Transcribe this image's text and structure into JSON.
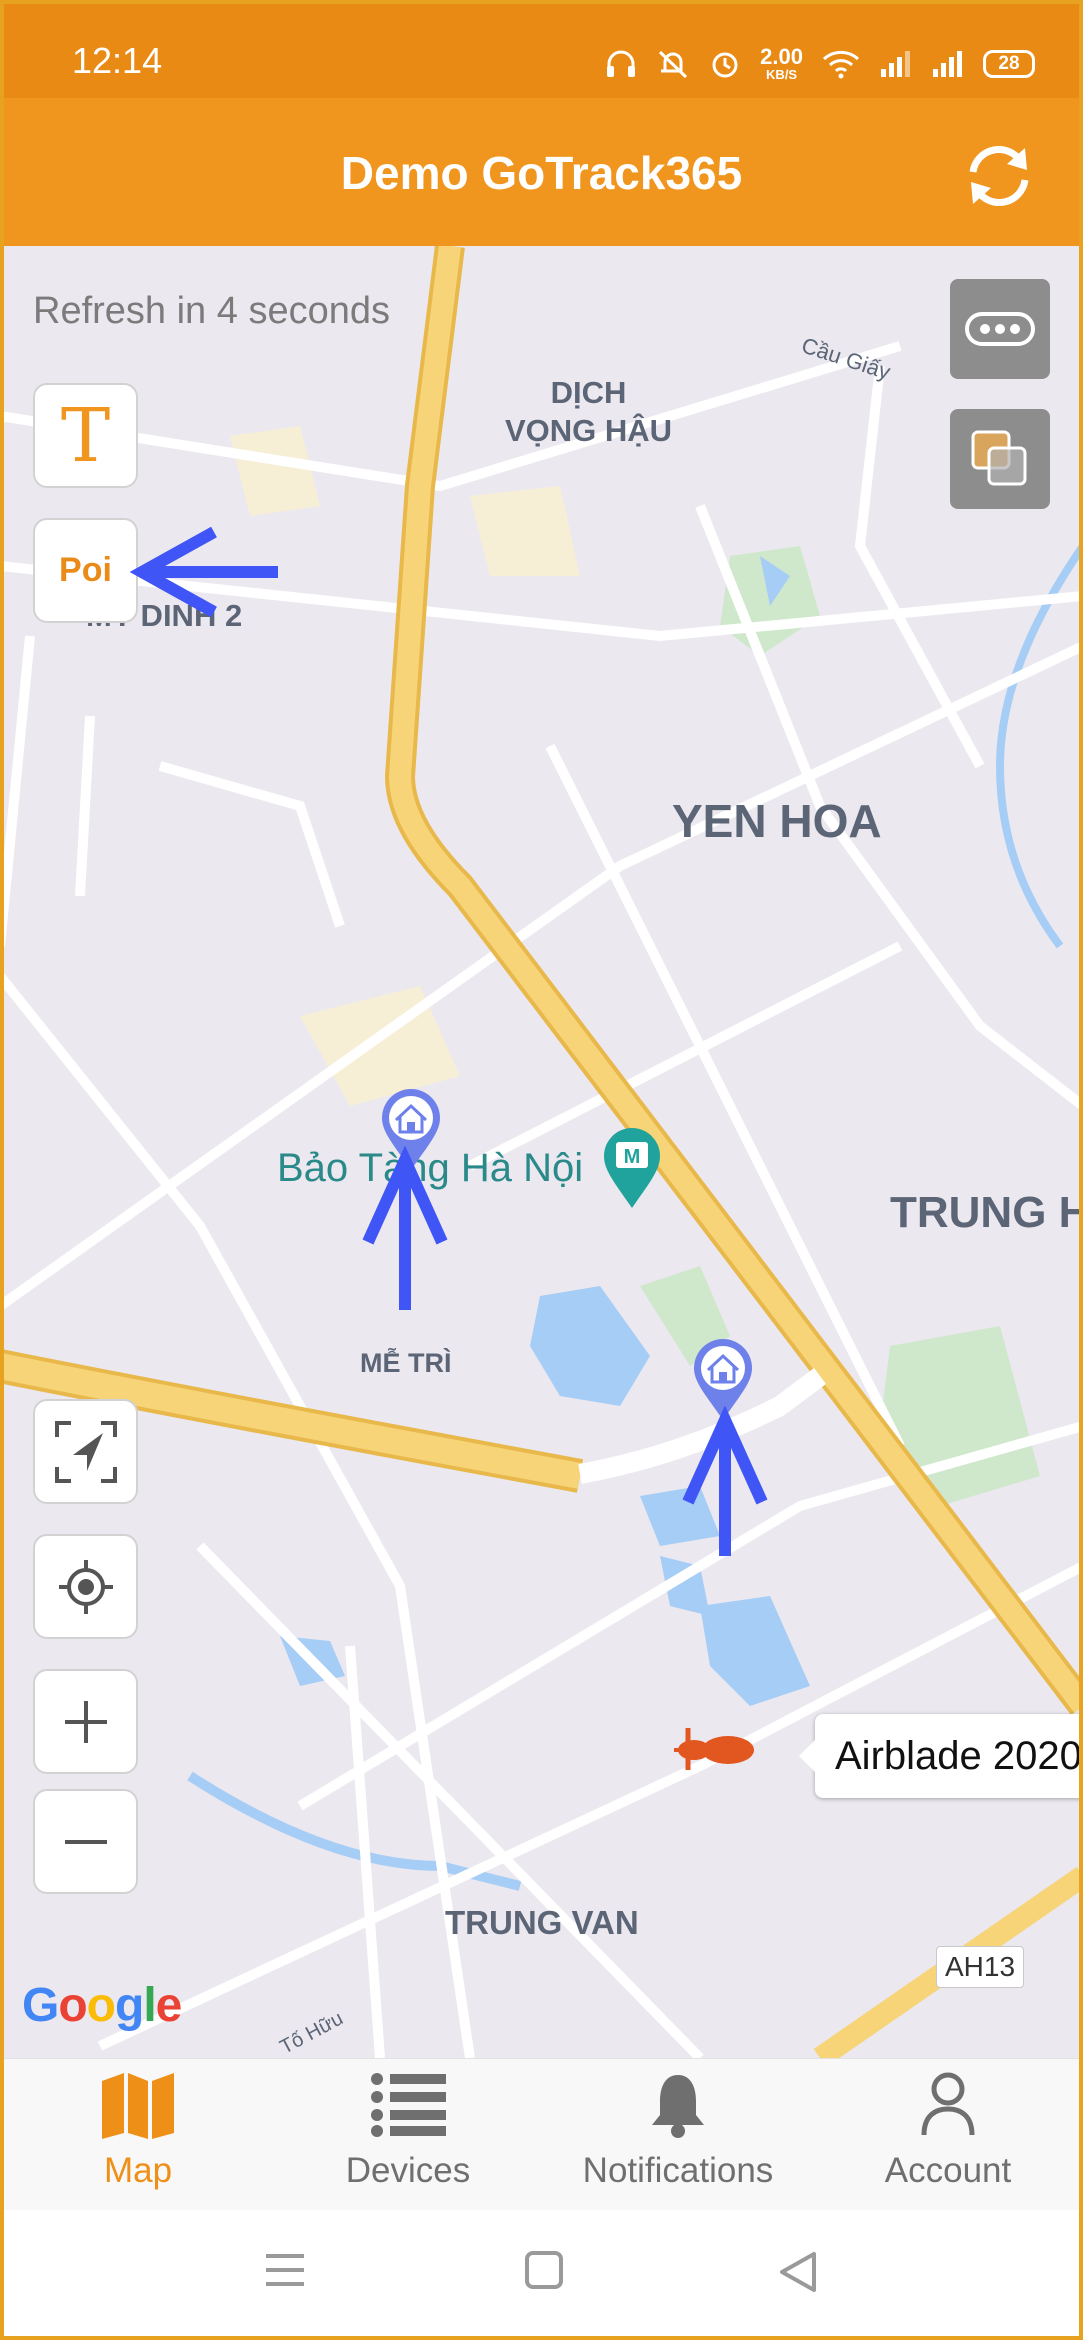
{
  "status_bar": {
    "time": "12:14",
    "net_speed_value": "2.00",
    "net_speed_unit": "KB/S",
    "battery": "28",
    "icons": [
      "headphones-icon",
      "mute-icon",
      "alarm-icon",
      "wifi-icon",
      "signal-icon",
      "signal-icon"
    ]
  },
  "app_bar": {
    "title": "Demo GoTrack365",
    "action_icon": "refresh-icon"
  },
  "map": {
    "refresh_text": "Refresh in 4 seconds",
    "text_toggle_label": "T",
    "poi_label": "Poi",
    "more_icon": "more-icon",
    "layers_icon": "layers-icon",
    "labels": {
      "dich_vong_hau": "DỊCH\nVỌNG HẬU",
      "my_dinh_2": "MY DINH 2",
      "yen_hoa": "YEN HOA",
      "trung_h": "TRUNG H",
      "bao_tang": "Bảo Tàng Hà Nội",
      "me_tri": "MỄ TRÌ",
      "trung_van": "TRUNG VAN",
      "cau_giay": "Cầu Giấy",
      "to_huu": "Tố Hữu"
    },
    "vehicle_label": "Airblade 2020",
    "route_badge": "AH13",
    "google_logo": "Google",
    "controls": [
      "fit-bounds-icon",
      "my-location-icon",
      "zoom-in-icon",
      "zoom-out-icon"
    ],
    "colors": {
      "highway": "#f6d477",
      "water": "#a6cdf6",
      "park": "#cfe8cc",
      "accent": "#f0951e",
      "arrow": "#3f55f5"
    }
  },
  "bottom_nav": {
    "items": [
      {
        "label": "Map",
        "icon": "map-icon",
        "active": true
      },
      {
        "label": "Devices",
        "icon": "list-icon",
        "active": false
      },
      {
        "label": "Notifications",
        "icon": "bell-icon",
        "active": false
      },
      {
        "label": "Account",
        "icon": "person-icon",
        "active": false
      }
    ]
  },
  "system_nav": [
    "menu-icon",
    "home-icon",
    "back-icon"
  ]
}
